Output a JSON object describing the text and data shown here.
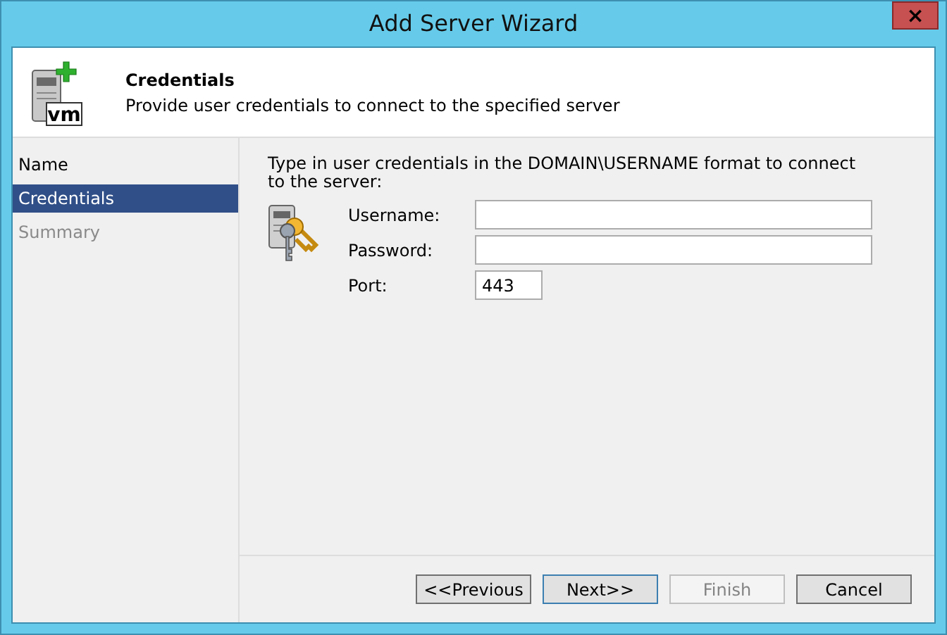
{
  "window": {
    "title": "Add Server Wizard",
    "close": "×"
  },
  "header": {
    "title": "Credentials",
    "subtitle": "Provide user credentials to connect to the specified server",
    "icon_label": "vm"
  },
  "steps": [
    {
      "label": "Name",
      "selected": false,
      "disabled": false
    },
    {
      "label": "Credentials",
      "selected": true,
      "disabled": false
    },
    {
      "label": "Summary",
      "selected": false,
      "disabled": true
    }
  ],
  "instructions": "Type in user credentials in the DOMAIN\\USERNAME format to connect to the server:",
  "fields": [
    {
      "label": "Username:",
      "kind": "text"
    },
    {
      "label": "Password:",
      "kind": "password"
    },
    {
      "label": "Port:",
      "value": "443",
      "kind": "port"
    }
  ],
  "buttons": [
    {
      "label": "<<Previous",
      "disabled": false,
      "default": false
    },
    {
      "label": "Next>>",
      "disabled": false,
      "default": true
    },
    {
      "label": "Finish",
      "disabled": true,
      "default": false
    },
    {
      "label": "Cancel",
      "disabled": false,
      "default": false
    }
  ]
}
